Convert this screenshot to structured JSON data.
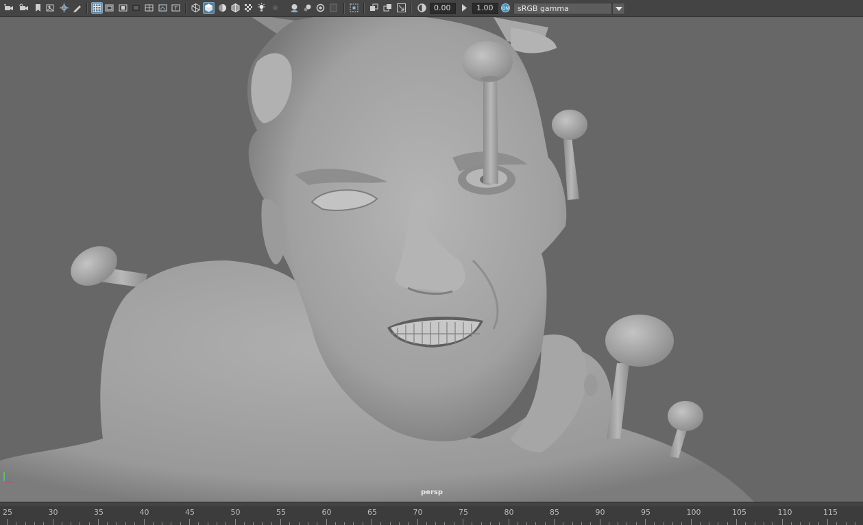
{
  "toolbar": {
    "icons": [
      "camera-select-icon",
      "camera-lock-icon",
      "bookmark-icon",
      "image-plane-icon",
      "2d-pan-zoom-icon",
      "grease-pencil-icon",
      "grid-icon",
      "film-gate-icon",
      "resolution-gate-icon",
      "gate-mask-icon",
      "field-chart-icon",
      "safe-action-icon",
      "wireframe-icon",
      "smooth-shade-icon",
      "default-material-icon",
      "shaded-wireframe-icon",
      "textured-icon",
      "use-all-lights-icon",
      "shadows-icon",
      "ambient-occlusion-icon",
      "motion-blur-icon",
      "anti-aliasing-icon",
      "depth-of-field-icon",
      "isolate-select-icon",
      "xray-icon",
      "xray-active-icon",
      "xray-joints-icon",
      "exposure-icon",
      "gamma-icon",
      "color-management-icon"
    ],
    "exposure_value": "0.00",
    "gamma_value": "1.00",
    "color_space": "sRGB gamma"
  },
  "viewport": {
    "camera_label": "persp"
  },
  "timeline": {
    "ticks": [
      "25",
      "30",
      "35",
      "40",
      "45",
      "50",
      "55",
      "60",
      "65",
      "70",
      "75",
      "80",
      "85",
      "90",
      "95",
      "100",
      "105",
      "110",
      "115"
    ]
  }
}
